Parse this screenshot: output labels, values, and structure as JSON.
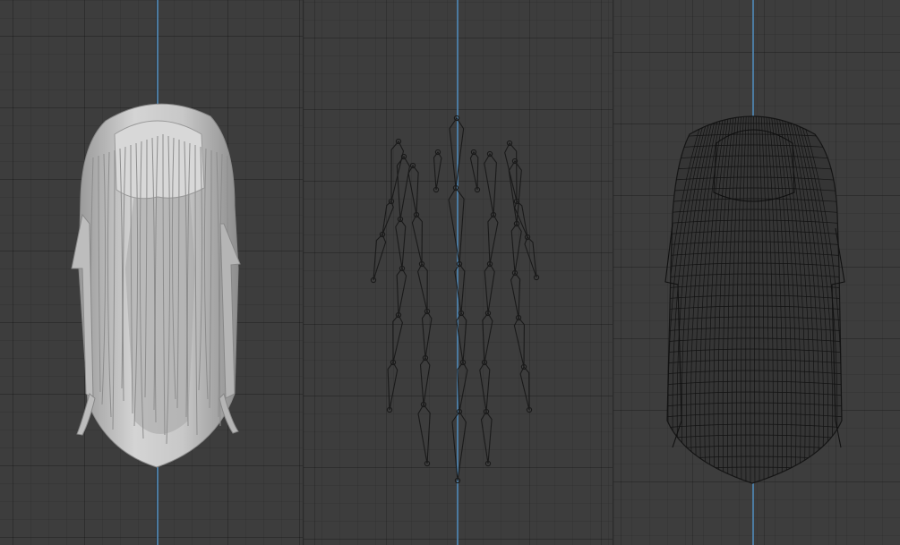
{
  "scene": {
    "colors": {
      "background": "#3d3d3d",
      "grid": "#2f2f2f",
      "axis": "#4f86b3",
      "solid_hair": "#c9c9c9",
      "bone": "#1c1c1c",
      "wire": "#111111"
    },
    "viewports": [
      {
        "id": "left",
        "shading": "solid"
      },
      {
        "id": "middle",
        "shading": "armature"
      },
      {
        "id": "right",
        "shading": "wireframe"
      }
    ]
  }
}
